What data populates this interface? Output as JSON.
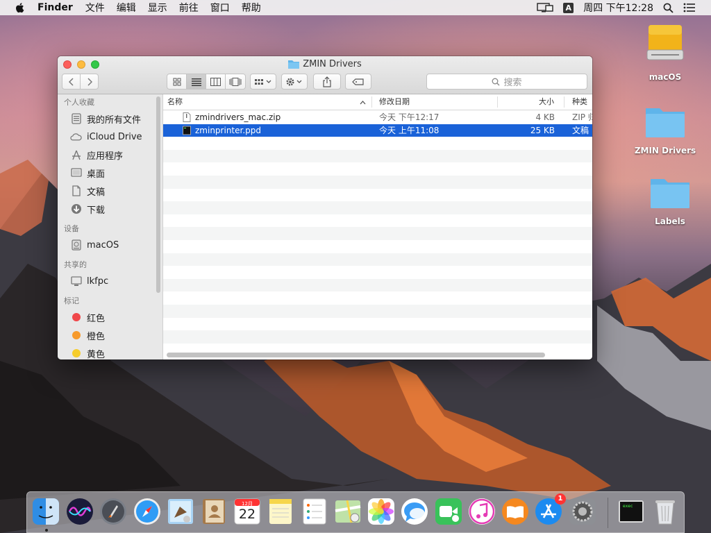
{
  "menubar": {
    "app_name": "Finder",
    "items": [
      "文件",
      "编辑",
      "显示",
      "前往",
      "窗口",
      "帮助"
    ],
    "input_method": "A",
    "clock": "周四 下午12:28"
  },
  "desktop": {
    "icons": [
      {
        "label": "macOS",
        "type": "drive-icon"
      },
      {
        "label": "ZMIN Drivers",
        "type": "folder-icon"
      },
      {
        "label": "Labels",
        "type": "folder-icon"
      }
    ]
  },
  "window": {
    "title": "ZMIN Drivers",
    "search_placeholder": "搜索",
    "sidebar": {
      "sections": [
        {
          "heading": "个人收藏",
          "items": [
            {
              "label": "我的所有文件",
              "icon": "all-files-icon"
            },
            {
              "label": "iCloud Drive",
              "icon": "cloud-icon"
            },
            {
              "label": "应用程序",
              "icon": "applications-icon"
            },
            {
              "label": "桌面",
              "icon": "desktop-icon"
            },
            {
              "label": "文稿",
              "icon": "documents-icon"
            },
            {
              "label": "下载",
              "icon": "downloads-icon"
            }
          ]
        },
        {
          "heading": "设备",
          "items": [
            {
              "label": "macOS",
              "icon": "disk-icon"
            }
          ]
        },
        {
          "heading": "共享的",
          "items": [
            {
              "label": "lkfpc",
              "icon": "computer-icon"
            }
          ]
        },
        {
          "heading": "标记",
          "items": [
            {
              "label": "红色",
              "color": "#f0474a"
            },
            {
              "label": "橙色",
              "color": "#f79a2b"
            },
            {
              "label": "黄色",
              "color": "#f6cd2c"
            }
          ]
        }
      ]
    },
    "columns": {
      "name": "名称",
      "date": "修改日期",
      "size": "大小",
      "kind": "种类"
    },
    "files": [
      {
        "name": "zmindrivers_mac.zip",
        "date": "今天 下午12:17",
        "size": "4 KB",
        "kind": "ZIP 归档",
        "selected": false
      },
      {
        "name": "zminprinter.ppd",
        "date": "今天 上午11:08",
        "size": "25 KB",
        "kind": "文稿",
        "selected": true
      }
    ]
  },
  "dock": {
    "items": [
      "finder-icon",
      "siri-icon",
      "launchpad-icon",
      "safari-icon",
      "mail-icon",
      "contacts-icon",
      "calendar-icon",
      "notes-icon",
      "reminders-icon",
      "maps-icon",
      "photos-icon",
      "messages-icon",
      "facetime-icon",
      "itunes-icon",
      "ibooks-icon",
      "app-store-icon",
      "system-preferences-icon",
      "terminal-icon",
      "trash-icon"
    ],
    "calendar_month": "12月",
    "calendar_day": "22",
    "app_store_badge": "1",
    "terminal_text": "exec"
  }
}
